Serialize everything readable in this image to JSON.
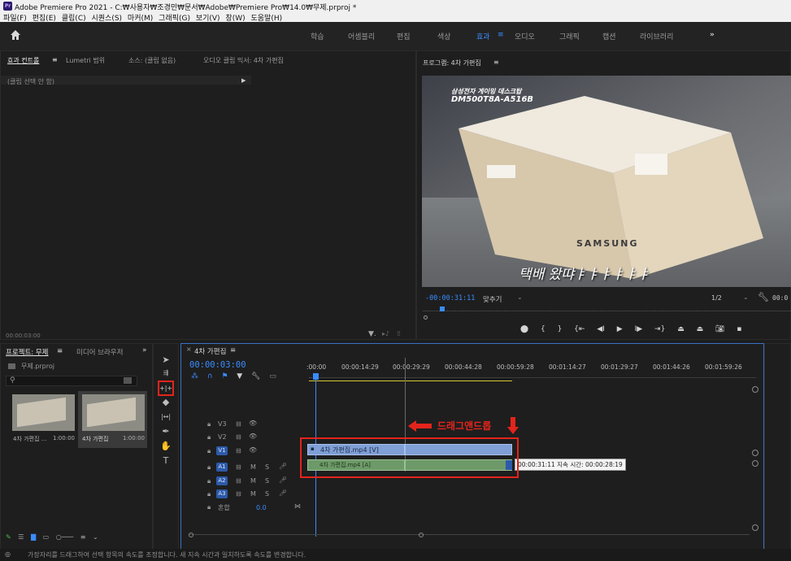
{
  "titlebar": {
    "app_icon": "Pr",
    "title": "Adobe Premiere Pro 2021 - C:₩사용자₩조경민₩문서₩Adobe₩Premiere Pro₩14.0₩무제.prproj *",
    "menu": "파일(F) 편집(E) 클립(C) 시퀀스(S) 마커(M) 그래픽(G) 보기(V) 창(W) 도움말(H)"
  },
  "workspace": {
    "items": [
      "학습",
      "어셈블리",
      "편집",
      "색상",
      "효과",
      "오디오",
      "그래픽",
      "캡션",
      "라이브러리"
    ],
    "active": "효과",
    "more": "»"
  },
  "effect_controls": {
    "tabs": [
      "효과 컨트롤",
      "Lumetri 범위",
      "소스: (클립 없음)",
      "오디오 클립 믹서: 4차 가편집"
    ],
    "no_clip": "(클립 선택 안 함)",
    "timecode": "00:00:03:00"
  },
  "program": {
    "tab": "프로그램: 4차 가편집",
    "overlay_line1": "삼성전자 게이밍 데스크탑",
    "overlay_line2": "DM500T8A-A516B",
    "brand": "SAMSUNG",
    "subtitle": "택배 왔땨ㅑㅑㅑㅑㅑㅑ",
    "timecode": "-00:00:31:11",
    "fit": "맞추기",
    "resolution": "1/2",
    "right_tc": "00:0"
  },
  "project": {
    "tabs": [
      "프로젝트: 무제",
      "미디어 브라우저"
    ],
    "file": "무제.prproj",
    "items": [
      {
        "name": "4차 가편집 ...",
        "duration": "1:00:00"
      },
      {
        "name": "4차 가편집",
        "duration": "1:00:00"
      }
    ]
  },
  "timeline": {
    "tab": "4차 가편집",
    "timecode": "00:00:03:00",
    "ruler": [
      ":00:00",
      "00:00:14:29",
      "00:00:29:29",
      "00:00:44:28",
      "00:00:59:28",
      "00:01:14:27",
      "00:01:29:27",
      "00:01:44:26",
      "00:01:59:26"
    ],
    "tracks": [
      "V3",
      "V2",
      "V1",
      "A1",
      "A2",
      "A3"
    ],
    "mix_label": "혼합",
    "mix_value": "0.0",
    "clip_label": "4차 가편집.mp4 [V]",
    "annotation": "드래그앤드롭",
    "tooltip": "00:00:31:11 지속 시간: 00:00:28:19",
    "audio_clip_text": "4차 가편집.mp4 [A]"
  },
  "status": {
    "text": "가장자리를 드래그하여 선택 항목의 속도를 조정합니다. 새 지속 시간과 일치하도록 속도를 변경합니다."
  },
  "colors": {
    "accent": "#3a8cff",
    "highlight": "#e3241b",
    "clip_video": "#7f9fd6",
    "clip_audio": "#6d9a68"
  }
}
